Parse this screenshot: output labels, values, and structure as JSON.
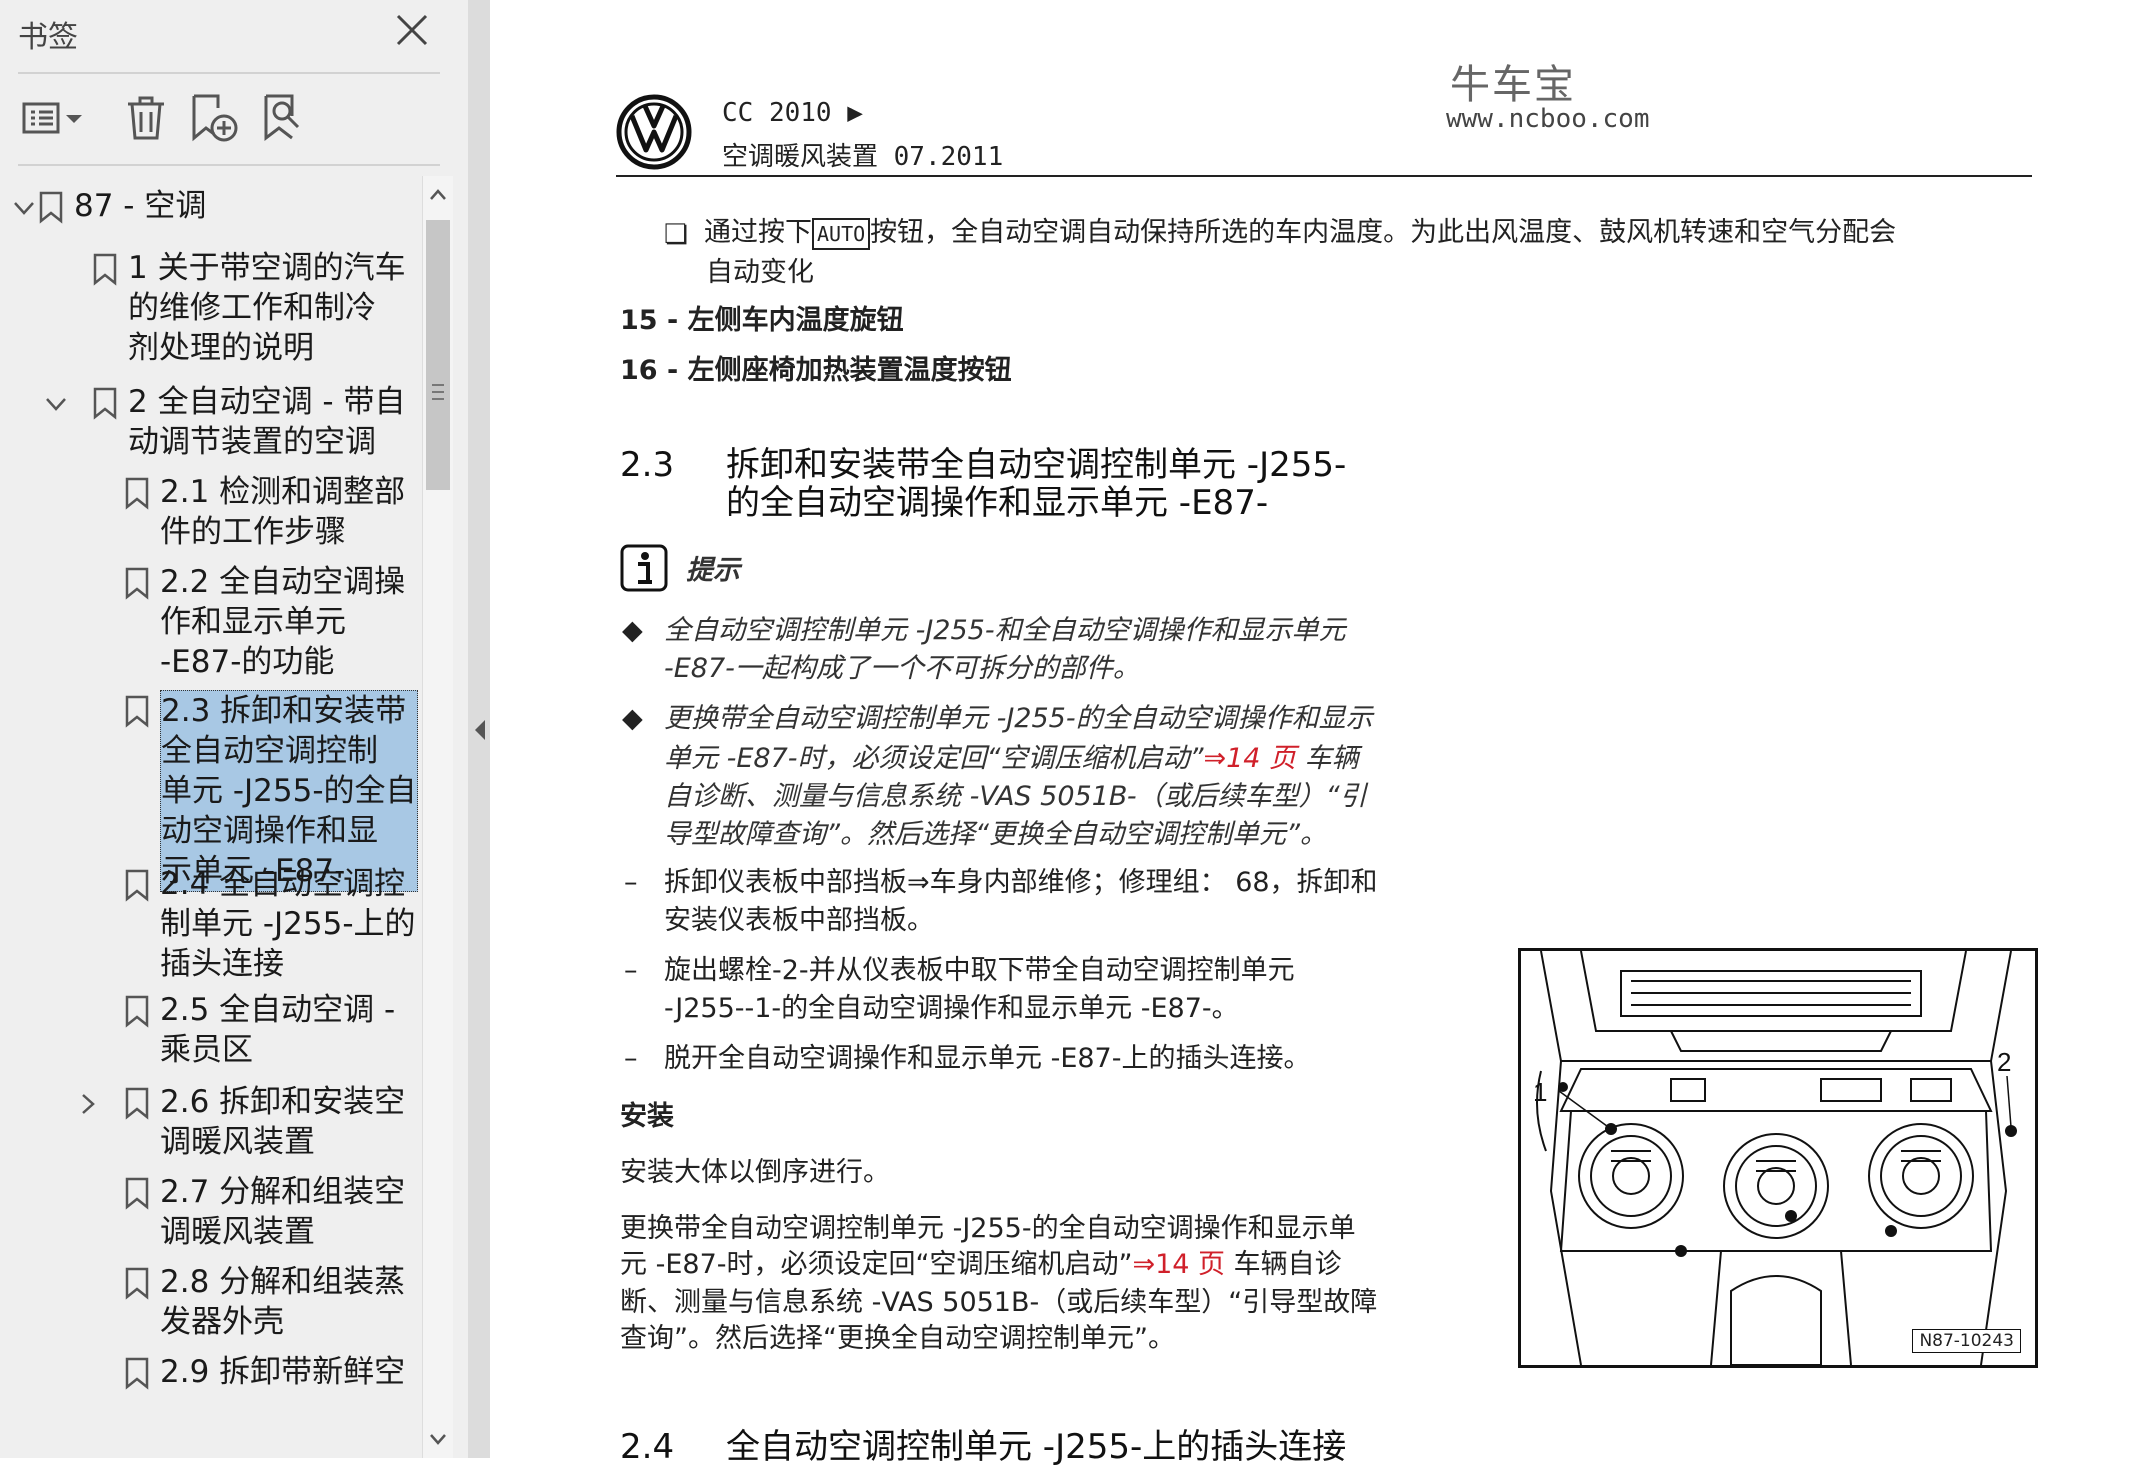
{
  "sidebar": {
    "title": "书签",
    "tree": [
      {
        "text": "87 - 空调",
        "level": 0,
        "expanded": true
      },
      {
        "text": "1 关于带空调的汽车\n的维修工作和制冷\n剂处理的说明",
        "level": 1
      },
      {
        "text": "2 全自动空调 - 带自\n动调节装置的空调",
        "level": 1,
        "expanded": true
      },
      {
        "text": "2.1 检测和调整部\n件的工作步骤",
        "level": 2
      },
      {
        "text": "2.2 全自动空调操\n作和显示单元\n-E87-的功能",
        "level": 2
      },
      {
        "text": "2.3 拆卸和安装带\n全自动空调控制\n单元 -J255-的全自\n动空调操作和显\n示单元 -E87-",
        "level": 2,
        "selected": true
      },
      {
        "text": "2.4 全自动空调控\n制单元 -J255-上的\n插头连接",
        "level": 2
      },
      {
        "text": "2.5 全自动空调 -\n乘员区",
        "level": 2
      },
      {
        "text": "2.6 拆卸和安装空\n调暖风装置",
        "level": 2,
        "collapsed": true
      },
      {
        "text": "2.7 分解和组装空\n调暖风装置",
        "level": 2
      },
      {
        "text": "2.8 分解和组装蒸\n发器外壳",
        "level": 2
      },
      {
        "text": "2.9 拆卸带新鲜空",
        "level": 2
      }
    ]
  },
  "doc": {
    "header_model": "CC 2010 ▶",
    "header_subtitle": "空调暖风装置 07.2011",
    "watermark_cn": "牛车宝",
    "watermark_url": "www.ncboo.com",
    "auto_prefix": "通过按下",
    "auto_button": "AUTO",
    "auto_suffix": "按钮，全自动空调自动保持所选的车内温度。为此出风温度、鼓风机转速和空气分配会",
    "auto_line2": "自动变化",
    "item15": "15 - 左侧车内温度旋钮",
    "item16": "16 - 左侧座椅加热装置温度按钮",
    "sec23_num": "2.3",
    "sec23_line1": "拆卸和安装带全自动空调控制单元 -J255-",
    "sec23_line2": "的全自动空调操作和显示单元 -E87-",
    "hint_label": "提示",
    "note1_l1": "全自动空调控制单元 -J255-和全自动空调操作和显示单元",
    "note1_l2": "-E87-一起构成了一个不可拆分的部件。",
    "note2_l1a": "更换带全自动空调控制单元 -J255-的全自动空调操作和显示",
    "note2_l2a": "单元 -E87-时，必须设定回“空调压缩机启动”",
    "note2_link": "⇒14 页",
    "note2_l2b": "车辆",
    "note2_l3": "自诊断、测量与信息系统 -VAS 5051B-（或后续车型）“引",
    "note2_l4": "导型故障查询”。然后选择“更换全自动空调控制单元”。",
    "step1_l1": "拆卸仪表板中部挡板⇒车身内部维修；修理组： 68，拆卸和",
    "step1_l2": "安装仪表板中部挡板。",
    "step2_l1": "旋出螺栓-2-并从仪表板中取下带全自动空调控制单元",
    "step2_l2": "-J255--1-的全自动空调操作和显示单元 -E87-。",
    "step3": "脱开全自动空调操作和显示单元 -E87-上的插头连接。",
    "install_title": "安装",
    "install_p1": "安装大体以倒序进行。",
    "install_p2_l1": "更换带全自动空调控制单元 -J255-的全自动空调操作和显示单",
    "install_p2_l2a": "元 -E87-时，必须设定回“空调压缩机启动”",
    "install_link": "⇒14 页",
    "install_p2_l2b": "车辆自诊",
    "install_p2_l3": "断、测量与信息系统 -VAS 5051B-（或后续车型）“引导型故障",
    "install_p2_l4": "查询”。然后选择“更换全自动空调控制单元”。",
    "sec24_num": "2.4",
    "sec24_title": "全自动空调控制单元 -J255-上的插头连接",
    "figure_callout1": "1",
    "figure_callout2": "2",
    "figure_caption": "N87-10243"
  },
  "icons": {
    "close": "close-icon",
    "view_options": "list-options-icon",
    "delete": "trash-icon",
    "add_bookmark": "add-bookmark-icon",
    "find_bookmark": "find-bookmark-icon",
    "bookmark": "bookmark-icon",
    "chevron_down": "chevron-down-icon",
    "chevron_right": "chevron-right-icon"
  },
  "colors": {
    "selection": "#a8c8e4",
    "link": "#d0202a",
    "sidebar_bg": "#efefef"
  }
}
